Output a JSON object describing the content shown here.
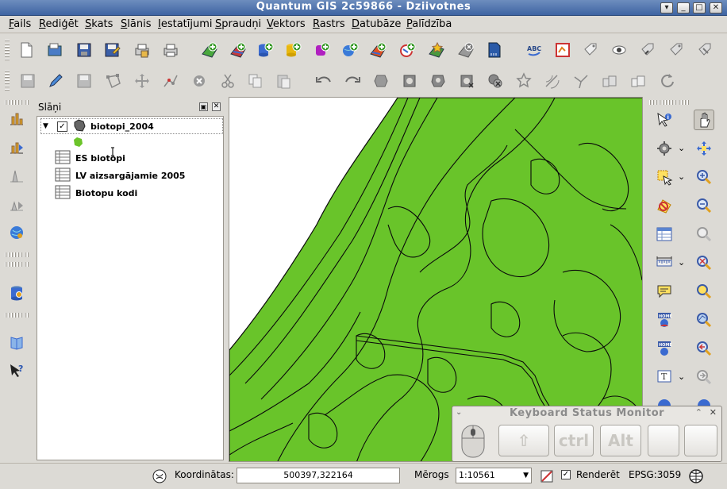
{
  "window": {
    "title": "Quantum GIS 2c59866 - Dziivotnes",
    "controls": [
      "minimize",
      "maximize",
      "close"
    ]
  },
  "menubar": {
    "items": [
      {
        "label": "Fails"
      },
      {
        "label": "Rediģēt"
      },
      {
        "label": "Skats"
      },
      {
        "label": "Slānis"
      },
      {
        "label": "Iestatījumi"
      },
      {
        "label": "Spraudņi"
      },
      {
        "label": "Vektors"
      },
      {
        "label": "Rastrs"
      },
      {
        "label": "Datubāze"
      },
      {
        "label": "Palīdzība"
      }
    ]
  },
  "layers_panel": {
    "title": "Slāņi",
    "layers": [
      {
        "label": "biotopi_2004",
        "checked": true,
        "type": "vector-polygon",
        "fill": "#6cc42a"
      },
      {
        "label": "ES biotopi",
        "type": "table"
      },
      {
        "label": "LV aizsargājamie 2005",
        "type": "table"
      },
      {
        "label": "Biotopu kodi",
        "type": "table"
      }
    ]
  },
  "map": {
    "background": "#ffffff",
    "fill": "#69c42a",
    "outline": "#0a0a0a"
  },
  "statusbar": {
    "coords_label": "Koordinātas:",
    "coords_value": "500397,322164",
    "scale_label": "Mērogs",
    "scale_value": "1:10561",
    "render_label": "Renderēt",
    "render_checked": true,
    "crs": "EPSG:3059"
  },
  "keyboard_monitor": {
    "title": "Keyboard Status Monitor",
    "keys": [
      "⇧",
      "ctrl",
      "Alt",
      "",
      ""
    ]
  }
}
